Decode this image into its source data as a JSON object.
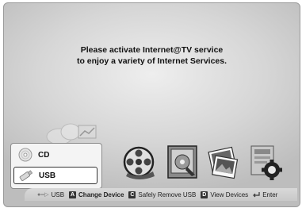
{
  "message": {
    "line1": "Please activate Internet@TV service",
    "line2": "to enjoy a variety of Internet Services."
  },
  "device_menu": {
    "items": [
      {
        "label": "CD",
        "icon": "disc-icon",
        "selected": false
      },
      {
        "label": "USB",
        "icon": "usb-drive-icon",
        "selected": true
      }
    ]
  },
  "apps": [
    {
      "icon": "film-reel-icon"
    },
    {
      "icon": "photo-album-icon"
    },
    {
      "icon": "photos-icon"
    },
    {
      "icon": "settings-gear-icon"
    }
  ],
  "help_bar": {
    "usb_label": "USB",
    "key_a": "A",
    "change_device": "Change Device",
    "key_c": "C",
    "safely_remove": "Safely Remove USB",
    "key_d": "D",
    "view_devices": "View Devices",
    "enter": "Enter"
  }
}
